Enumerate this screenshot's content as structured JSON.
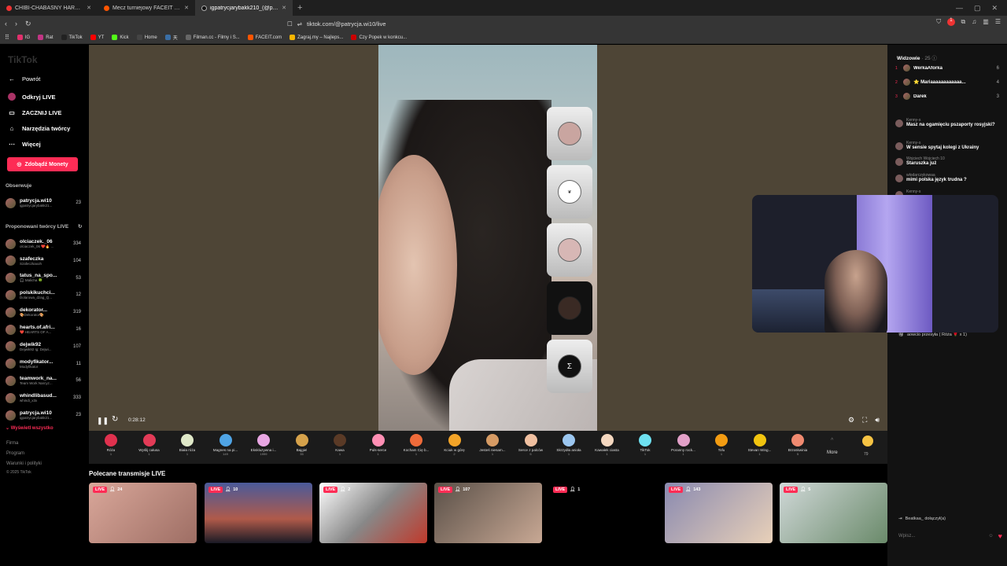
{
  "browser": {
    "tabs": [
      {
        "title": "CHIBI-CHABAŚNY HARDSTYLOWY"
      },
      {
        "title": "Mecz turniejowy FACEIT - FACEIT.com"
      },
      {
        "title": "igpatrycjarybakk210_(@patr..."
      }
    ],
    "new_tab": "+",
    "url": "tiktok.com/@patrycja.wi10/live",
    "ext_badge": "1",
    "bookmarks": [
      {
        "label": "IG",
        "color": "#e1306c"
      },
      {
        "label": "Rat",
        "color": "#c13584"
      },
      {
        "label": "TikTok",
        "color": "#222222"
      },
      {
        "label": "YT",
        "color": "#ff0000"
      },
      {
        "label": "Kick",
        "color": "#53fc18"
      },
      {
        "label": "Home",
        "color": "#444444"
      },
      {
        "label": "天",
        "color": "#3a6ea5"
      },
      {
        "label": "Filman.cc - Filmy i S...",
        "color": "#666666"
      },
      {
        "label": "FACEIT.com",
        "color": "#ff5500"
      },
      {
        "label": "Zagraj.my – Najleps...",
        "color": "#f7b500"
      },
      {
        "label": "Czy Popek w konkcu...",
        "color": "#cc0000"
      }
    ]
  },
  "sidebar": {
    "logo": "TikTok",
    "back": "Powrót",
    "nav": [
      "Odkryj LIVE",
      "ZACZNIJ LIVE",
      "Narzędzia twórcy",
      "Więcej"
    ],
    "coins_btn": "Zdobądź Monety",
    "followed_label": "Obserwuje",
    "followed": [
      {
        "name": "patrycja.wi10",
        "sub": "igpatrycjarybakk21...",
        "count": "23"
      }
    ],
    "suggested_label": "Proponowani twórcy LIVE",
    "suggested": [
      {
        "name": "olciaczek._06",
        "sub": "olciaczek_06 ❤️🔥 ...",
        "count": "334"
      },
      {
        "name": "szafeczka",
        "sub": "Szafeczkaxoh",
        "count": "104"
      },
      {
        "name": "tatus_na_spo...",
        "sub": "🎧 Malicha 🍀",
        "count": "53"
      },
      {
        "name": "polskikuchci...",
        "sub": "Dolarowa_dzag_Q...",
        "count": "12"
      },
      {
        "name": "dekorator...",
        "sub": "🎨Dekorator🎨",
        "count": "319"
      },
      {
        "name": "hearts.of.afri...",
        "sub": "❤️ HEARTS OF A...",
        "count": "16"
      },
      {
        "name": "dejwik92",
        "sub": "Dejwik92 Ig: Dejwi...",
        "count": "107"
      },
      {
        "name": "modyfikator...",
        "sub": "Modyfikator",
        "count": "11"
      },
      {
        "name": "teamwork_na...",
        "sub": "Team Work Narcyz...",
        "count": "56"
      },
      {
        "name": "whindlibasud...",
        "sub": "whindi_x3x",
        "count": "333"
      },
      {
        "name": "patrycja.wi10",
        "sub": "igpatrycjarybakk21...",
        "count": "23"
      }
    ],
    "show_all": "⌄ Wyświetl wszystko",
    "footer": [
      "Firma",
      "Program",
      "Warunki i polityki",
      "© 2025 TikTok"
    ]
  },
  "player": {
    "time": "0:28:12"
  },
  "gifts": [
    {
      "name": "Róża",
      "price": "1",
      "color": "#e0314e"
    },
    {
      "name": "Wyślij całusa",
      "price": "1",
      "color": "#e33b57"
    },
    {
      "name": "Biała róża",
      "price": "1",
      "color": "#dfe8c8"
    },
    {
      "name": "Magnes na pi...",
      "price": "149",
      "color": "#4fa4e5"
    },
    {
      "name": "Ekskluzywna i...",
      "price": "1999",
      "color": "#e8a6e3"
    },
    {
      "name": "Bajgiel",
      "price": "35",
      "color": "#d6a24b"
    },
    {
      "name": "Kawa",
      "price": "1",
      "color": "#5a3a26"
    },
    {
      "name": "Puls-serce",
      "price": "1",
      "color": "#ff8fb4"
    },
    {
      "name": "Kocham Cię b...",
      "price": "1",
      "color": "#ef6b3a"
    },
    {
      "name": "Kciuk w górę",
      "price": "2",
      "color": "#f3a428"
    },
    {
      "name": "Jesteś niesam...",
      "price": "1",
      "color": "#d69b64"
    },
    {
      "name": "Serce z palców",
      "price": "5",
      "color": "#f0c0a0"
    },
    {
      "name": "Skrzydła anioła",
      "price": "1",
      "color": "#9bc6ef"
    },
    {
      "name": "Kawałek ciasta",
      "price": "1",
      "color": "#f5d8c0"
    },
    {
      "name": "TikTok",
      "price": "1",
      "color": "#6ee0f0"
    },
    {
      "name": "Poranny rock...",
      "price": "1",
      "color": "#e2a0c8"
    },
    {
      "name": "Tofu",
      "price": "1",
      "color": "#f39c12"
    },
    {
      "name": "Stevan Wing...",
      "price": "1",
      "color": "#f1c40f"
    },
    {
      "name": "Brzoskwinia",
      "price": "5",
      "color": "#f08a70"
    }
  ],
  "gift_more": "More",
  "coin_count": "79",
  "recommended": {
    "title": "Polecane transmisje LIVE",
    "live_label": "LIVE",
    "cards": [
      {
        "viewers": "24",
        "bg": "linear-gradient(135deg,#d9a79a,#9e6e64)"
      },
      {
        "viewers": "10",
        "bg": "linear-gradient(180deg,#4a5a9a,#b05a4a 60%,#1a1a25)"
      },
      {
        "viewers": "2",
        "bg": "linear-gradient(135deg,#ffffff,#888888 50%,#c0392b)"
      },
      {
        "viewers": "107",
        "bg": "linear-gradient(135deg,#5a5048,#c8a894)"
      },
      {
        "viewers": "1",
        "bg": "#000000"
      },
      {
        "viewers": "143",
        "bg": "linear-gradient(135deg,#8a8ab0,#e8d0b8)"
      },
      {
        "viewers": "5",
        "bg": "linear-gradient(135deg,#d0d8d8,#6a8a6a)"
      }
    ]
  },
  "chat": {
    "viewers_label": "Widzowie",
    "viewers_count": "· 25",
    "top_viewers": [
      {
        "rank": "1",
        "name": "WerkaAforka",
        "score": "6"
      },
      {
        "rank": "2",
        "name": "⭐ Mariaaaaaaaaaaaa...",
        "score": "4"
      },
      {
        "rank": "3",
        "name": "Darek",
        "score": "3"
      }
    ],
    "messages": [
      {
        "user": "Kenny-s",
        "text": "Masz na ogamięciu pszaporty rosyjski?"
      },
      {
        "user": "Kenny-s",
        "text": "W sensie spytaj kolegi z Ukrainy"
      },
      {
        "user": "Wojciech Wojciech 10",
        "text": "Staruszka już"
      },
      {
        "user": "włodarczykowaa",
        "text": "mimi polska język trudna ?"
      },
      {
        "user": "Kenny-s",
        "text": ""
      }
    ],
    "gift_msg": "aowcio przesyła ( Róża 🌹 x 1)",
    "join_msg": "Beatkaa_ dołączył(a)",
    "input_placeholder": "Wpisz..."
  }
}
